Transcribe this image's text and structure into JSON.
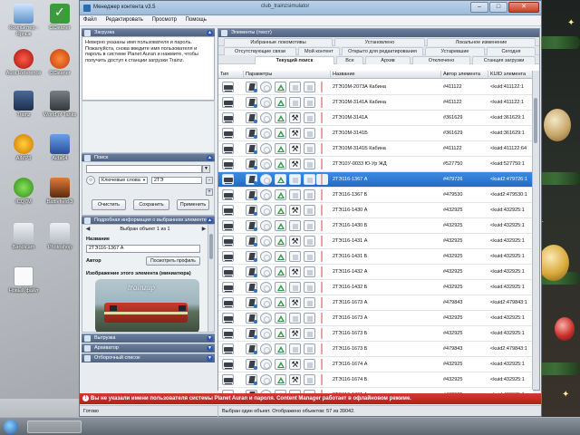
{
  "window": {
    "title": "Менеджер контента v3.5",
    "center_title": "club_trainzsimulator",
    "btn_min": "–",
    "btn_max": "□",
    "btn_close": "✕"
  },
  "menu": [
    "Файл",
    "Редактировать",
    "Просмотр",
    "Помощь"
  ],
  "desktop_icons": [
    {
      "label": "Компьютер - Ярлык",
      "icon": "computer-icon"
    },
    {
      "label": "CCleaner",
      "icon": "ccleaner-icon"
    },
    {
      "label": "Aura Reference",
      "icon": "aura-icon"
    },
    {
      "label": "CCleaner",
      "icon": "ccleaner-icon"
    },
    {
      "label": "Trainz",
      "icon": "trainz-icon"
    },
    {
      "label": "World of Tanks",
      "icon": "wot-icon"
    },
    {
      "label": "AIMP3",
      "icon": "aimp-icon"
    },
    {
      "label": "Aida64",
      "icon": "aida-icon"
    },
    {
      "label": "ICQ7M",
      "icon": "icq-icon"
    },
    {
      "label": "Battlefield 3",
      "icon": "bf3-icon"
    },
    {
      "label": "Bandicam",
      "icon": "bandicam-icon"
    },
    {
      "label": "Photoshop",
      "icon": "photoshop-icon"
    },
    {
      "label": "Новый файл",
      "icon": "file-icon"
    }
  ],
  "left": {
    "login_section": "Загрузка",
    "login_text": "Неверно указаны имя пользователя и пароль. Пожалуйста, снова введите имя пользователя и пароль в системе Planet Auran и нажмите, чтобы получить доступ к станции загрузки Trainz.",
    "search_section": "Поиск",
    "search_field_value": "",
    "search_kind": "Ключевые слова",
    "search_query": "2ТЭ",
    "btn_clear": "Очистить",
    "btn_save": "Сохранить",
    "btn_apply": "Применить",
    "details_section": "Подробная информация о выбранном элементе",
    "selected_line": "Выбран объект 1 из 1",
    "name_label": "Название",
    "name_value": "2ТЭ116-1367 А",
    "author_label": "Автор",
    "profile_btn": "Посмотреть профиль",
    "thumb_label": "Изображение этого элемента (миниатюра)",
    "thumb_brand": "trainzup",
    "collapsed": [
      "Выгрузка",
      "Архиватор",
      "Отборочный список"
    ]
  },
  "right": {
    "section": "Элементы (текст)",
    "tabs_row1": [
      "Избранные локомотивы",
      "Установлено",
      "Локальное изменение"
    ],
    "tabs_row2": [
      "Отсутствующие связи",
      "Мой контент",
      "Открыто для редактирования",
      "Устаревшие",
      "Сегодня"
    ],
    "tabs_row3": [
      "Текущий поиск",
      "Все",
      "Архив",
      "Отключено",
      "Станция загрузки"
    ],
    "columns": [
      "Тип",
      "Параметры",
      "Название",
      "Автор элемента",
      "KUID элемента"
    ],
    "rows": [
      {
        "name": "2ТЭ10М-2073А Кабина",
        "author": "#411122",
        "kuid": "<kuid:411122:1",
        "tool": false
      },
      {
        "name": "2ТЭ10М-3141А Кабина",
        "author": "#411122",
        "kuid": "<kuid:411122:1",
        "tool": false
      },
      {
        "name": "2ТЭ10М-3141А",
        "author": "#361629",
        "kuid": "<kuid:361629:1",
        "tool": true
      },
      {
        "name": "2ТЭ10М-3141Б",
        "author": "#361629",
        "kuid": "<kuid:361629:1",
        "tool": true
      },
      {
        "name": "2ТЭ10М-3141Б Кабина",
        "author": "#411122",
        "kuid": "<kuid:411122:64",
        "tool": true
      },
      {
        "name": "2ТЭ10У-0033 Ю-Ур ЖД",
        "author": "#527750",
        "kuid": "<kuid:527750:1",
        "tool": true
      },
      {
        "name": "2ТЭ116-1367 А",
        "author": "#479726",
        "kuid": "<kuid2:479726:1",
        "tool": false,
        "selected": true
      },
      {
        "name": "2ТЭ116-1367 Б",
        "author": "#479530",
        "kuid": "<kuid2:479530:1",
        "tool": false
      },
      {
        "name": "2ТЭ116-1430 А",
        "author": "#432925",
        "kuid": "<kuid:432925:1",
        "tool": true
      },
      {
        "name": "2ТЭ116-1430 Б",
        "author": "#432925",
        "kuid": "<kuid:432925:1",
        "tool": false
      },
      {
        "name": "2ТЭ116-1431 А",
        "author": "#432925",
        "kuid": "<kuid:432925:1",
        "tool": true
      },
      {
        "name": "2ТЭ116-1431 Б",
        "author": "#432925",
        "kuid": "<kuid:432925:1",
        "tool": false
      },
      {
        "name": "2ТЭ116-1432 А",
        "author": "#432925",
        "kuid": "<kuid:432925:1",
        "tool": true
      },
      {
        "name": "2ТЭ116-1432 Б",
        "author": "#432925",
        "kuid": "<kuid:432925:1",
        "tool": false
      },
      {
        "name": "2ТЭ116-1673 А",
        "author": "#479843",
        "kuid": "<kuid2:479843:1",
        "tool": true
      },
      {
        "name": "2ТЭ116-1673 А",
        "author": "#432925",
        "kuid": "<kuid:432925:1",
        "tool": false
      },
      {
        "name": "2ТЭ116-1673 Б",
        "author": "#432925",
        "kuid": "<kuid:432925:1",
        "tool": true
      },
      {
        "name": "2ТЭ116-1673 Б",
        "author": "#479843",
        "kuid": "<kuid2:479843:1",
        "tool": false
      },
      {
        "name": "2ТЭ116-1674 А",
        "author": "#432925",
        "kuid": "<kuid:432925:1",
        "tool": true
      },
      {
        "name": "2ТЭ116-1674 Б",
        "author": "#432925",
        "kuid": "<kuid:432925:1",
        "tool": true
      },
      {
        "name": "2ТЭ116-1701 А",
        "author": "#432925",
        "kuid": "<kuid:432925:1",
        "tool": false
      }
    ]
  },
  "status_red": "Вы не указали имени пользователя системы Planet Auran и пароля. Content Manager работает в офлайновом режиме.",
  "status_left": "Готово",
  "status_right": "Выбран один объект. Отображено объектов: 57 из 39042."
}
